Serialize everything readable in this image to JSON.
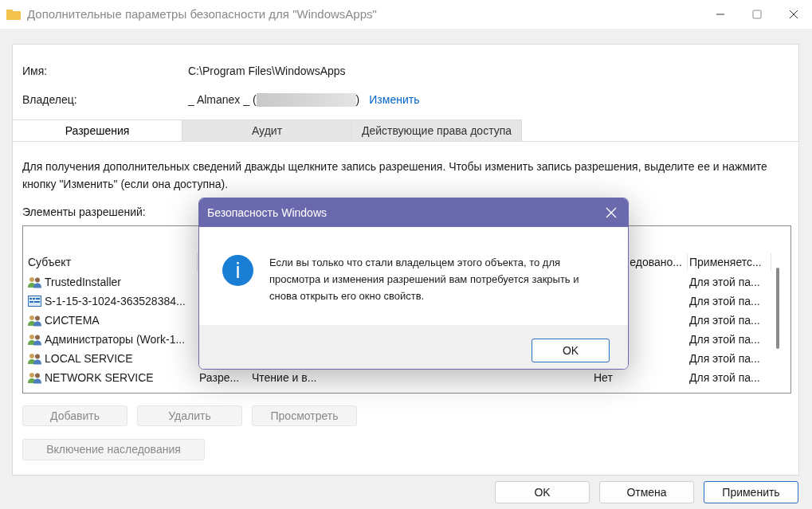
{
  "window": {
    "title": "Дополнительные параметры безопасности  для \"WindowsApps\""
  },
  "fields": [
    {
      "label": "Имя:",
      "value": "C:\\Program Files\\WindowsApps"
    },
    {
      "label": "Владелец:",
      "value": "_ Almanex _ (",
      "value_end": ")",
      "link": "Изменить"
    }
  ],
  "tabs": [
    {
      "label": "Разрешения",
      "selected": true
    },
    {
      "label": "Аудит",
      "selected": false
    },
    {
      "label": "Действующие права доступа",
      "selected": false
    }
  ],
  "info_text": "Для получения дополнительных сведений дважды щелкните запись разрешения. Чтобы изменить запись разрешения, выделите ее и нажмите кнопку \"Изменить\" (если она доступна).",
  "list_label": "Элементы разрешений:",
  "table": {
    "columns": [
      "Субъект",
      "",
      "",
      "едовано...",
      "Применяетс..."
    ],
    "rows": [
      {
        "kind": "group",
        "cells": [
          "TrustedInstaller",
          "",
          "",
          "",
          "Для этой па..."
        ]
      },
      {
        "kind": "sid",
        "cells": [
          "S-1-15-3-1024-363528384...",
          "",
          "",
          "",
          "Для этой па..."
        ]
      },
      {
        "kind": "group",
        "cells": [
          "СИСТЕМА",
          "",
          "",
          "",
          "Для этой па..."
        ]
      },
      {
        "kind": "group",
        "cells": [
          "Администраторы (Work-1...",
          "",
          "",
          "",
          "Для этой па..."
        ]
      },
      {
        "kind": "group",
        "cells": [
          "LOCAL SERVICE",
          "",
          "",
          "",
          "Для этой па..."
        ]
      },
      {
        "kind": "group",
        "cells": [
          "NETWORK SERVICE",
          "Разре...",
          "Чтение и в...",
          "Нет",
          "Для этой па..."
        ]
      }
    ]
  },
  "list_buttons": [
    {
      "label": "Добавить",
      "disabled": true
    },
    {
      "label": "Удалить",
      "disabled": true
    },
    {
      "label": "Просмотреть",
      "disabled": true
    }
  ],
  "inherit_button": {
    "label": "Включение наследования",
    "disabled": true
  },
  "footer_buttons": [
    {
      "label": "OK",
      "default": false
    },
    {
      "label": "Отмена",
      "default": false
    },
    {
      "label": "Применить",
      "default": true
    }
  ],
  "dialog": {
    "title": "Безопасность Windows",
    "message": "Если вы только что стали владельцем этого объекта, то для просмотра и изменения разрешений вам потребуется закрыть и снова открыть его окно свойств.",
    "button": "OK"
  }
}
